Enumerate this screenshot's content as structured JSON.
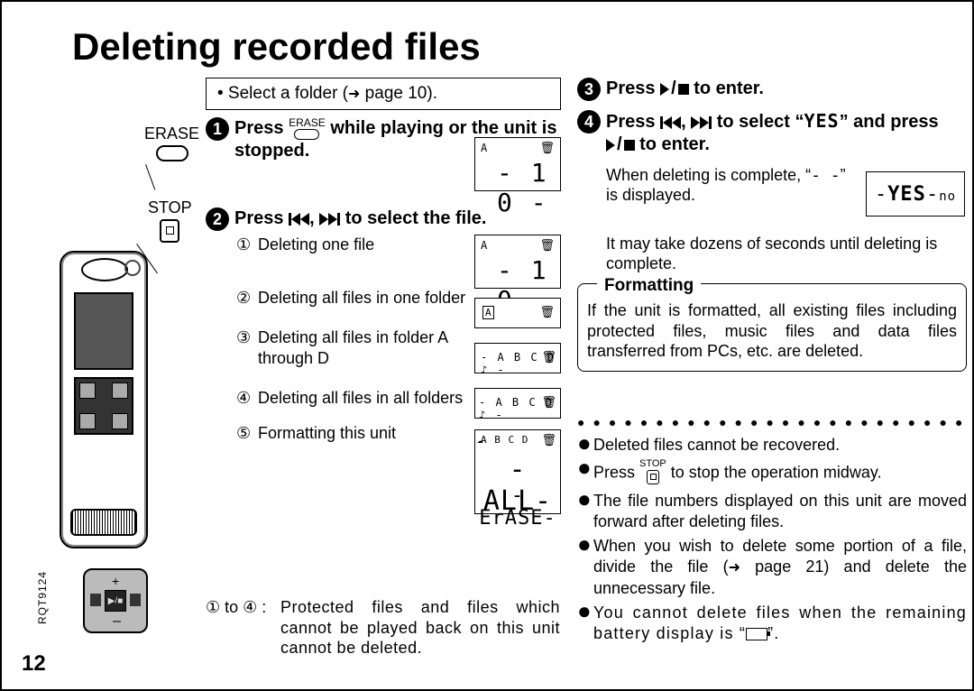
{
  "title": "Deleting recorded files",
  "intro": {
    "prefix": "• Select a folder (",
    "suffix": " page 10)."
  },
  "labels": {
    "erase": "ERASE",
    "stop": "STOP"
  },
  "steps": {
    "s1": {
      "n": "1",
      "a": "Press ",
      "b": " while playing or the unit is stopped."
    },
    "s2": {
      "n": "2",
      "a": "Press ",
      "b": " to select the file."
    },
    "s3": {
      "n": "3",
      "a": "Press ",
      "b": " to enter."
    },
    "s4": {
      "n": "4",
      "a": "Press ",
      "b": " to select “",
      "c": "” and press ",
      "d": " to enter."
    }
  },
  "options": {
    "o1": "Deleting one file",
    "o2": "Deleting all files in one folder",
    "o3": "Deleting all files in folder A through D",
    "o4": "Deleting all files in all folders",
    "o5": "Formatting this unit"
  },
  "lcd_big": {
    "top": "A B C D",
    "mid": "A L L",
    "bot": "E r A S E"
  },
  "proto_note": {
    "lbl": "① to ④ :",
    "txt": "Protected files and files which cannot be played back on this unit cannot be deleted."
  },
  "yes_seg": "Y E S",
  "when_text": {
    "a": "When deleting is complete, “",
    "dash": "- -",
    "b": "” is displayed."
  },
  "lcd_yes": "-YES-no",
  "maytake": "It may take dozens of seconds until deleting is complete.",
  "fmt": {
    "title": "Formatting",
    "body": "If the unit is formatted, all existing files including protected files, music files and data files transferred from PCs, etc. are deleted."
  },
  "notes": {
    "n1": "Deleted files cannot be recovered.",
    "n2a": "Press ",
    "n2b": " to stop the operation midway.",
    "n3": "The file numbers displayed on this unit are moved forward after deleting files.",
    "n4a": "When you wish to delete some portion of a file, divide the file (",
    "n4b": " page 21) and delete the unnecessary file.",
    "n5a": "You cannot delete files when the remaining battery display is “",
    "n5b": "”."
  },
  "doc_id": "RQT9124",
  "page_number": "12",
  "glyphs": {
    "c1": "①",
    "c2": "②",
    "c3": "③",
    "c4": "④",
    "c5": "⑤"
  }
}
